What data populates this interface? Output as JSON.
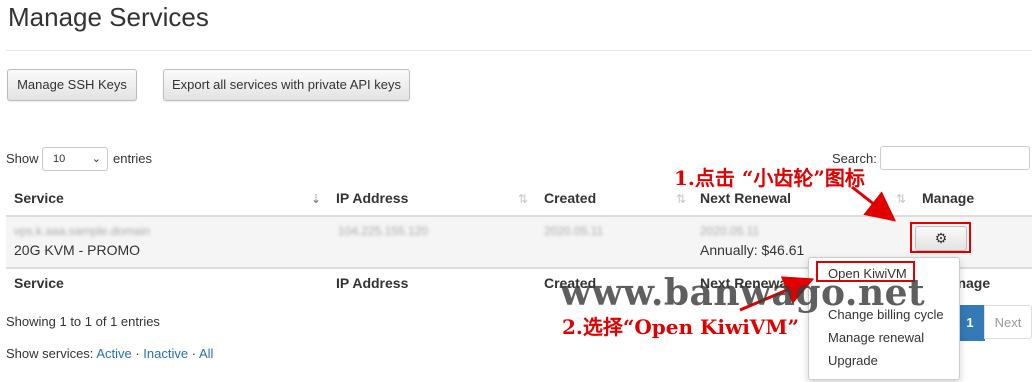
{
  "page": {
    "title": "Manage Services"
  },
  "actions": {
    "ssh_keys": "Manage SSH Keys",
    "export": "Export all services with private API keys"
  },
  "length_control": {
    "show": "Show",
    "value": "10",
    "entries": "entries"
  },
  "search": {
    "label": "Search:",
    "value": ""
  },
  "table": {
    "headers": [
      "Service",
      "IP Address",
      "Created",
      "Next Renewal",
      "Manage"
    ],
    "row": {
      "service_name": "vps.k.aaa.sample.domain",
      "service_plan": "20G KVM - PROMO",
      "ip": "104.225.155.120",
      "created": "2020.05.11",
      "renewal_date": "2020.05.11",
      "renewal_price": "Annually: $46.61"
    }
  },
  "footer": {
    "info": "Showing 1 to 1 of 1 entries",
    "services_label": "Show services:",
    "active": "Active",
    "inactive": "Inactive",
    "all": "All"
  },
  "pagination": {
    "current": "1",
    "next": "Next"
  },
  "dropdown": {
    "items": [
      "Open KiwiVM",
      "Change billing cycle",
      "Manage renewal",
      "Upgrade"
    ]
  },
  "annotations": {
    "step1": "1.点击 “小齿轮”图标",
    "step2": "2.选择“Open KiwiVM”",
    "watermark": "www.banwago.net"
  },
  "icons": {
    "gear": "gear-icon",
    "caret": "chevron-down-icon"
  },
  "colors": {
    "annotation_red": "#e00000",
    "link_blue": "#2a6fb5",
    "page_active": "#337ab7"
  }
}
